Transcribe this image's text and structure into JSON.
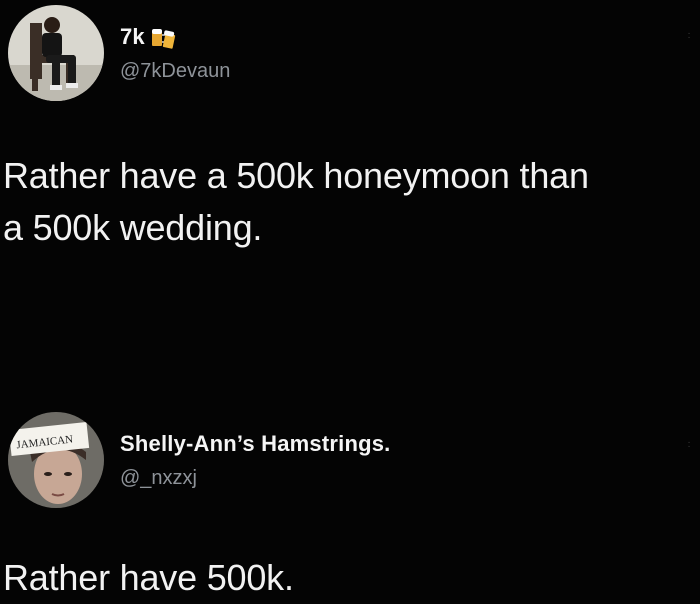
{
  "tweets": [
    {
      "display_name": "7k",
      "name_emoji": "beer-mugs-icon",
      "handle": "@7kDevaun",
      "text": "Rather have a 500k honeymoon than\na 500k wedding."
    },
    {
      "display_name": "Shelly-Ann’s Hamstrings.",
      "handle": "@_nxzxj",
      "avatar_sign_text": "JAMAICAN",
      "text": "Rather have 500k."
    }
  ],
  "colors": {
    "background": "#040404",
    "primary_text": "#f2f2f2",
    "secondary_text": "#8e9399"
  }
}
